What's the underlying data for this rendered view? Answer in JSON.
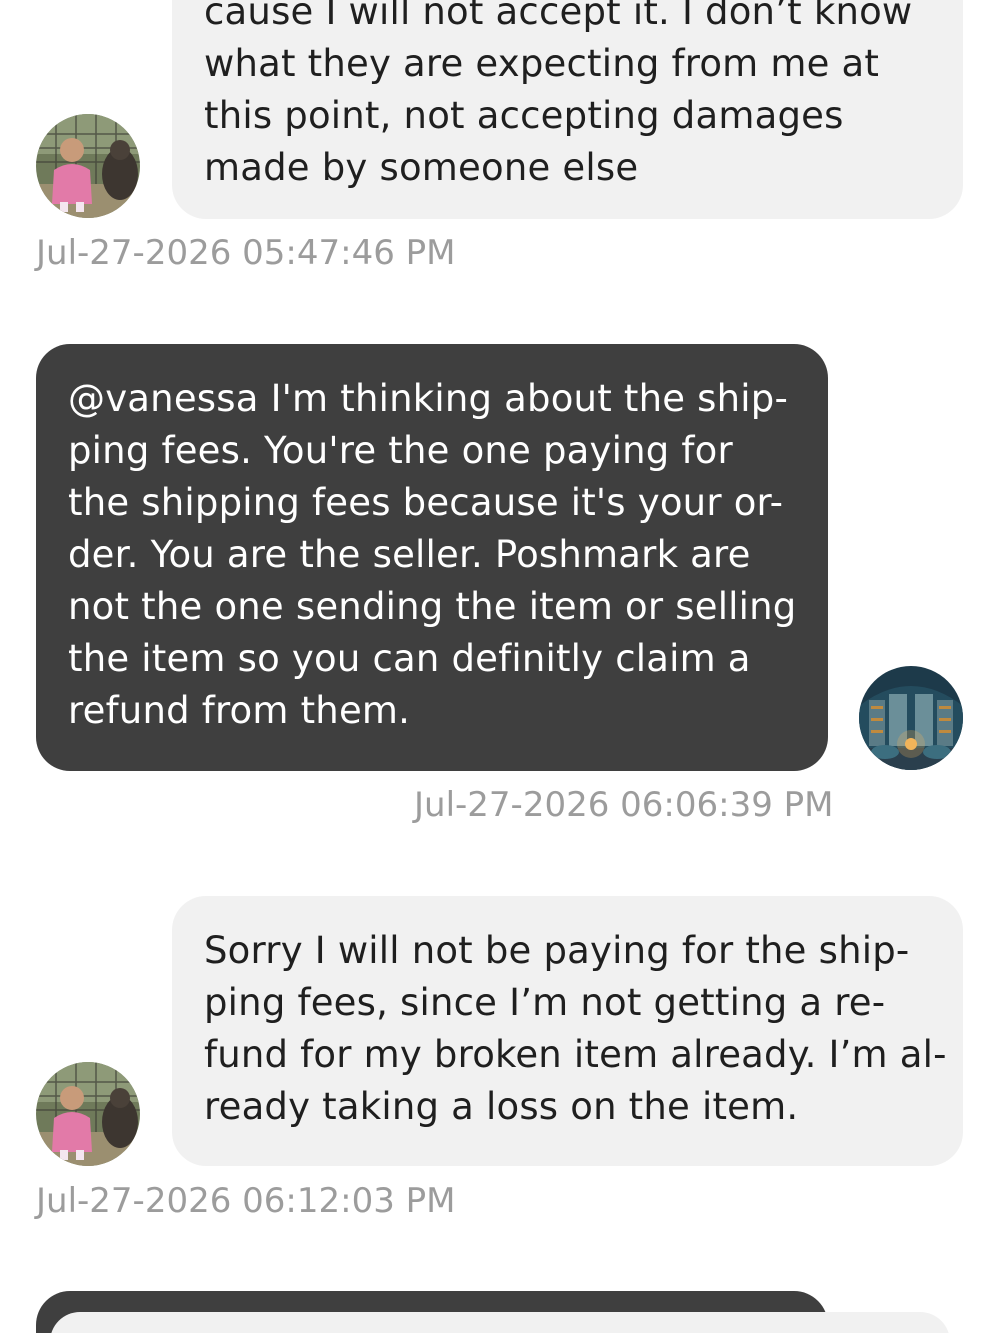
{
  "messages": [
    {
      "sender": "buyer",
      "lines": [
        "cause I will not accept it. I don’t know",
        "what they are expecting from me at",
        "this point, not accepting damages",
        "made by someone else"
      ],
      "timestamp": "Jul-27-2026 05:47:46 PM"
    },
    {
      "sender": "seller",
      "lines": [
        "@vanessa I'm thinking about the ship-",
        "ping fees. You're the one paying for",
        "the shipping fees because it's your or-",
        "der. You are the seller. Poshmark are",
        "not the one sending the item or selling",
        "the item so you can definitly claim a",
        "refund from them."
      ],
      "timestamp": "Jul-27-2026 06:06:39 PM"
    },
    {
      "sender": "buyer",
      "lines": [
        "Sorry I will not be paying for the ship-",
        "ping fees, since I’m not getting a re-",
        "fund for my broken item already. I’m al-",
        "ready taking a loss on the item."
      ],
      "timestamp": "Jul-27-2026 06:12:03 PM"
    }
  ],
  "avatars": {
    "buyer": "child-with-animal-avatar",
    "seller": "library-room-avatar"
  },
  "colors": {
    "incoming_bubble": "#f1f1f1",
    "outgoing_bubble": "#3f3f3f",
    "timestamp": "#9c9c9c"
  }
}
